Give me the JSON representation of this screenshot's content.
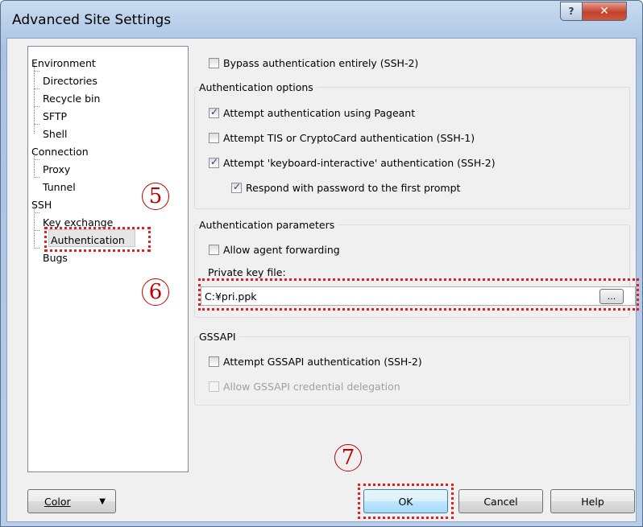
{
  "window": {
    "title": "Advanced Site Settings",
    "help_glyph": "?",
    "close_glyph": "✕"
  },
  "tree": {
    "environment": "Environment",
    "directories": "Directories",
    "recycle_bin": "Recycle bin",
    "sftp": "SFTP",
    "shell": "Shell",
    "connection": "Connection",
    "proxy": "Proxy",
    "tunnel": "Tunnel",
    "ssh": "SSH",
    "key_exchange": "Key exchange",
    "authentication": "Authentication",
    "bugs": "Bugs",
    "selected": "Authentication"
  },
  "markers": {
    "step5": "5",
    "step6": "6",
    "step7": "7"
  },
  "panel": {
    "bypass": {
      "label": "Bypass authentication entirely (SSH-2)",
      "checked": false
    },
    "auth_options": {
      "title": "Authentication options",
      "pageant": {
        "label": "Attempt authentication using Pageant",
        "checked": true
      },
      "tis": {
        "label": "Attempt TIS or CryptoCard authentication (SSH-1)",
        "checked": false
      },
      "keyboard": {
        "label": "Attempt 'keyboard-interactive' authentication (SSH-2)",
        "checked": true
      },
      "respond": {
        "label": "Respond with password to the first prompt",
        "checked": true
      }
    },
    "auth_params": {
      "title": "Authentication parameters",
      "agent_fwd": {
        "label": "Allow agent forwarding",
        "checked": false
      },
      "key_label": "Private key file:",
      "key_value": "C:¥pri.ppk",
      "browse": "..."
    },
    "gssapi": {
      "title": "GSSAPI",
      "attempt": {
        "label": "Attempt GSSAPI authentication (SSH-2)",
        "checked": false
      },
      "delegation": {
        "label": "Allow GSSAPI credential delegation",
        "checked": false,
        "disabled": true
      }
    }
  },
  "buttons": {
    "color": "Color",
    "ok": "OK",
    "cancel": "Cancel",
    "help": "Help"
  },
  "colors": {
    "highlight": "#e02020",
    "marker": "#c00000"
  }
}
